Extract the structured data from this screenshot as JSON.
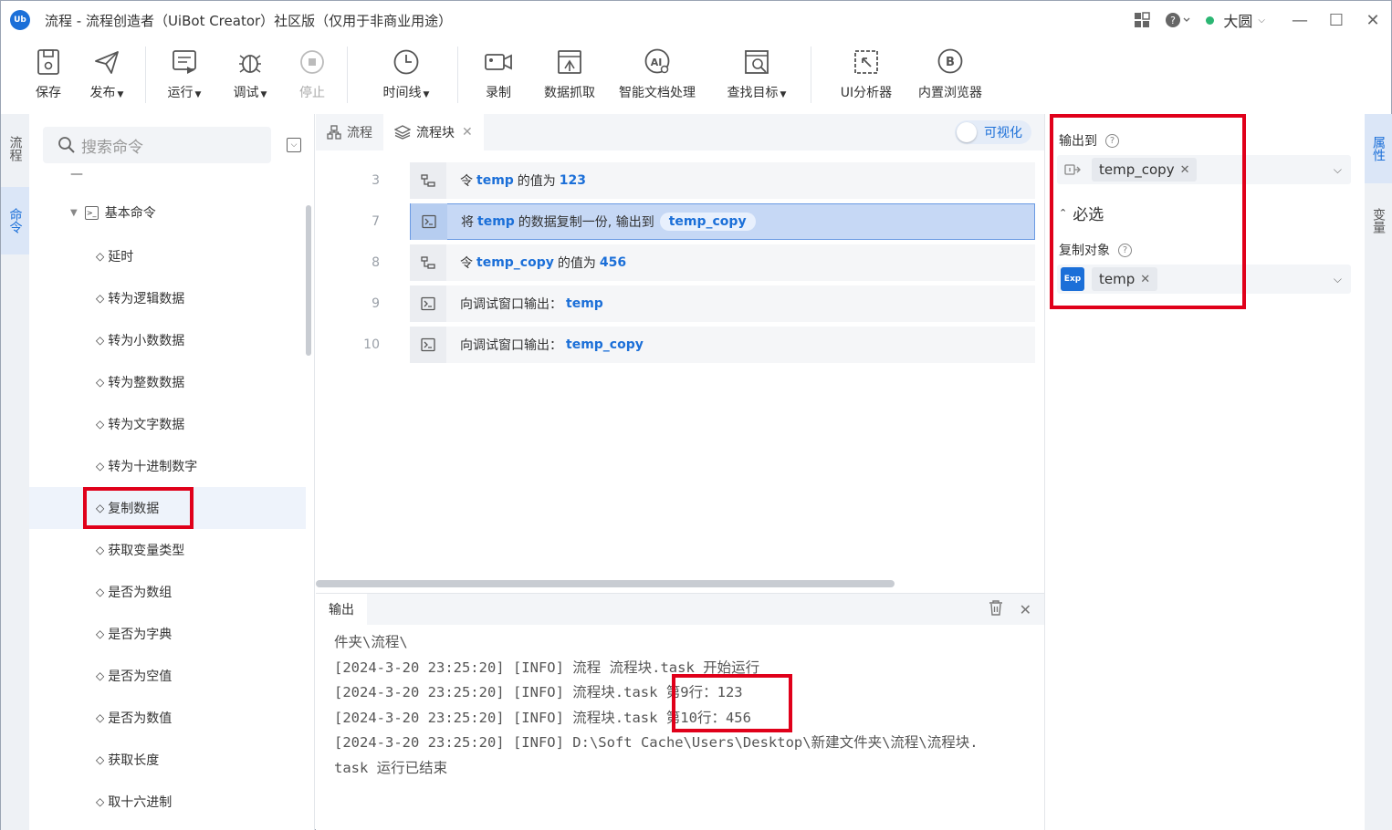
{
  "window": {
    "title": "流程 - 流程创造者（UiBot Creator）社区版（仅用于非商业用途）",
    "logo_text": "Ub",
    "user_name": "大圆"
  },
  "toolbar": {
    "save": "保存",
    "publish": "发布",
    "run": "运行",
    "debug": "调试",
    "stop": "停止",
    "timeline": "时间线",
    "record": "录制",
    "data_scrape": "数据抓取",
    "ai_doc": "智能文档处理",
    "find_target": "查找目标",
    "ui_analyzer": "UI分析器",
    "builtin_browser": "内置浏览器"
  },
  "left_strip": {
    "tab_flow": "流程",
    "tab_commands": "命令"
  },
  "commands": {
    "search_placeholder": "搜索命令",
    "dash": "—",
    "group": "基本命令",
    "items": [
      "延时",
      "转为逻辑数据",
      "转为小数数据",
      "转为整数数据",
      "转为文字数据",
      "转为十进制数字",
      "复制数据",
      "获取变量类型",
      "是否为数组",
      "是否为字典",
      "是否为空值",
      "是否为数值",
      "获取长度",
      "取十六进制"
    ]
  },
  "editor": {
    "tab_flow": "流程",
    "tab_block": "流程块",
    "visual_toggle": "可视化",
    "rows": [
      {
        "ln": "3",
        "pre": "令",
        "v1": "temp",
        "mid": "的值为",
        "v2": "123"
      },
      {
        "ln": "7",
        "pre": "将",
        "v1": "temp",
        "mid": "的数据复制一份, 输出到",
        "v2": "temp_copy"
      },
      {
        "ln": "8",
        "pre": "令",
        "v1": "temp_copy",
        "mid": "的值为",
        "v2": "456"
      },
      {
        "ln": "9",
        "pre": "向调试窗口输出：",
        "v1": "temp"
      },
      {
        "ln": "10",
        "pre": "向调试窗口输出：",
        "v1": "temp_copy"
      }
    ]
  },
  "output": {
    "tab": "输出",
    "lines": [
      "件夹\\流程\\",
      "[2024-3-20 23:25:20] [INFO] 流程 流程块.task 开始运行",
      "[2024-3-20 23:25:20] [INFO] 流程块.task 第9行：123",
      "[2024-3-20 23:25:20] [INFO] 流程块.task 第10行：456",
      "[2024-3-20 23:25:20] [INFO] D:\\Soft Cache\\Users\\Desktop\\新建文件夹\\流程\\流程块.",
      "task 运行已结束"
    ]
  },
  "properties": {
    "output_to_label": "输出到",
    "output_to_value": "temp_copy",
    "required_section": "必选",
    "copy_object_label": "复制对象",
    "copy_object_value": "temp",
    "exp_badge": "Exp"
  },
  "right_strip": {
    "tab_props": "属性",
    "tab_vars": "变量"
  },
  "colors": {
    "accent": "#1b6fd8",
    "highlight": "#e0001a",
    "selected_row": "#c6d8f5"
  }
}
